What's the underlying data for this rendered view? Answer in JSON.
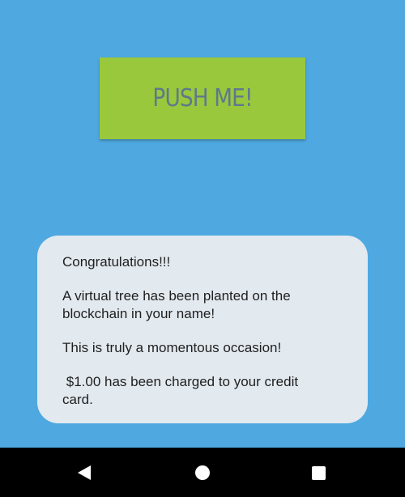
{
  "main": {
    "button_label": "PUSH ME!",
    "message": {
      "line1": "Congratulations!!!",
      "line2a": "A virtual tree has been planted on the",
      "line2b": "blockchain in your name!",
      "line3": "This is truly a momentous occasion!",
      "line4a": " $1.00 has been charged to your credit",
      "line4b": "card."
    }
  },
  "colors": {
    "background": "#4fa8e0",
    "button": "#9ac83c",
    "button_text": "#5e7a8a",
    "card": "#e2e9ef",
    "nav_bar": "#000000"
  },
  "nav": {
    "back_icon": "triangle-back-icon",
    "home_icon": "circle-home-icon",
    "recents_icon": "square-recents-icon"
  }
}
